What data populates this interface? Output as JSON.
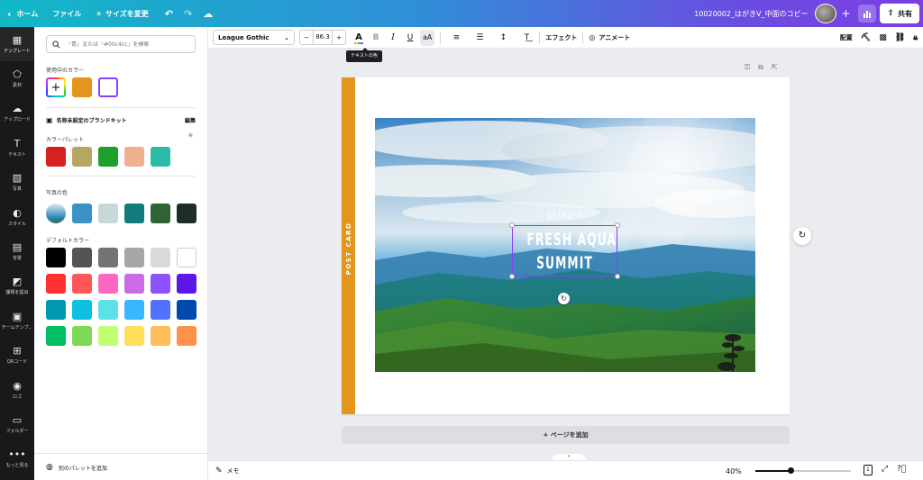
{
  "topbar": {
    "back_icon": "chevron-left-icon",
    "home_label": "ホーム",
    "file_label": "ファイル",
    "resize_label": "サイズを変更",
    "doc_title": "10020002_はがきV_中面のコピー",
    "share_label": "共有"
  },
  "rail": {
    "items": [
      {
        "label": "テンプレート",
        "icon": "template-icon"
      },
      {
        "label": "素材",
        "icon": "elements-icon"
      },
      {
        "label": "アップロード",
        "icon": "upload-icon"
      },
      {
        "label": "テキスト",
        "icon": "text-icon"
      },
      {
        "label": "写真",
        "icon": "photo-icon"
      },
      {
        "label": "スタイル",
        "icon": "style-icon"
      },
      {
        "label": "背景",
        "icon": "background-icon"
      },
      {
        "label": "課題を提出",
        "icon": "assignment-icon"
      },
      {
        "label": "チームテンプ...",
        "icon": "team-template-icon"
      },
      {
        "label": "QRコード",
        "icon": "qr-code-icon"
      },
      {
        "label": "ロゴ",
        "icon": "logo-icon"
      },
      {
        "label": "フォルダー",
        "icon": "folder-icon"
      },
      {
        "label": "もっと見る",
        "icon": "more-icon"
      }
    ]
  },
  "panel": {
    "search_placeholder": "「青」または「#00c4cc」を検索",
    "in_use_label": "使用中のカラー",
    "in_use_colors": [
      "#e3961b",
      "#ffffff"
    ],
    "brand_kit_title": "名称未設定のブランドキット",
    "brand_edit_label": "編集",
    "palette_label": "カラーパレット",
    "palette_colors": [
      "#d62121",
      "#b5a663",
      "#1e9e2a",
      "#eeb08f",
      "#2bbba6"
    ],
    "photo_colors_label": "写真の色",
    "photo_colors": [
      "#3a92c8",
      "#c8d8da",
      "#127b7e",
      "#2f6236",
      "#1f2d27"
    ],
    "default_colors_label": "デフォルトカラー",
    "default_colors": [
      "#000000",
      "#545454",
      "#737373",
      "#a6a6a6",
      "#d9d9d9",
      "#ffffff",
      "#ff3131",
      "#ff5757",
      "#ff66c4",
      "#cb6ce6",
      "#8c52ff",
      "#5e17eb",
      "#0097b2",
      "#0cc0df",
      "#5ce1e6",
      "#38b6ff",
      "#5271ff",
      "#004aad",
      "#00bf63",
      "#7ed957",
      "#c1ff72",
      "#ffde59",
      "#ffbd59",
      "#ff914d"
    ],
    "add_palette_label": "別のパレットを追加"
  },
  "toolbar": {
    "font_name": "League Gothic",
    "font_size": "86.3",
    "minus": "−",
    "plus": "+",
    "bold": "B",
    "italic": "I",
    "underline": "U",
    "case": "aA",
    "effects_label": "エフェクト",
    "animate_label": "アニメート",
    "position_label": "配置",
    "tooltip": "テキストの色"
  },
  "canvas": {
    "postcard_label": "POST CARD",
    "brand_text": "gilby's",
    "headline_line1": "FRESH AQUA",
    "headline_line2": "SUMMIT",
    "accent_color": "#e3961b",
    "add_page_label": "+ ページを追加"
  },
  "bottombar": {
    "memo_label": "メモ",
    "zoom": "40%",
    "zoom_fraction": 0.37,
    "page_number": "1"
  }
}
